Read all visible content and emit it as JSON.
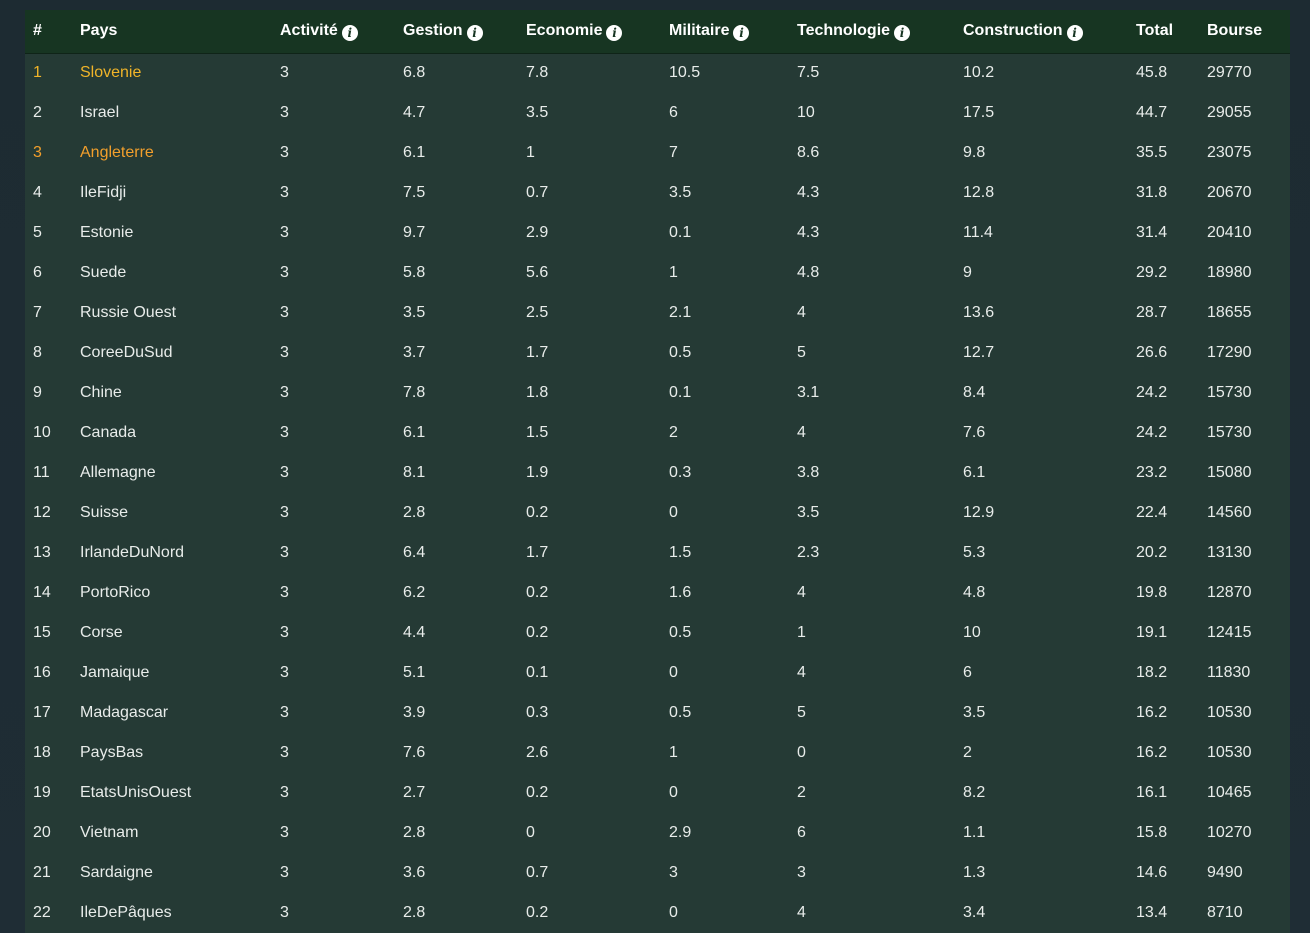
{
  "table": {
    "headers": {
      "rank": "#",
      "country": "Pays",
      "activity": "Activité",
      "management": "Gestion",
      "economy": "Economie",
      "military": "Militaire",
      "technology": "Technologie",
      "construction": "Construction",
      "total": "Total",
      "stock": "Bourse"
    },
    "info_icon_glyph": "i",
    "highlight_colors": {
      "gold": "#f0b429",
      "orange": "#f29f2c"
    },
    "rows": [
      {
        "rank": "1",
        "country": "Slovenie",
        "activity": "3",
        "management": "6.8",
        "economy": "7.8",
        "military": "10.5",
        "technology": "7.5",
        "construction": "10.2",
        "total": "45.8",
        "stock": "29770",
        "highlight": "gold"
      },
      {
        "rank": "2",
        "country": "Israel",
        "activity": "3",
        "management": "4.7",
        "economy": "3.5",
        "military": "6",
        "technology": "10",
        "construction": "17.5",
        "total": "44.7",
        "stock": "29055",
        "highlight": ""
      },
      {
        "rank": "3",
        "country": "Angleterre",
        "activity": "3",
        "management": "6.1",
        "economy": "1",
        "military": "7",
        "technology": "8.6",
        "construction": "9.8",
        "total": "35.5",
        "stock": "23075",
        "highlight": "orange"
      },
      {
        "rank": "4",
        "country": "IleFidji",
        "activity": "3",
        "management": "7.5",
        "economy": "0.7",
        "military": "3.5",
        "technology": "4.3",
        "construction": "12.8",
        "total": "31.8",
        "stock": "20670",
        "highlight": ""
      },
      {
        "rank": "5",
        "country": "Estonie",
        "activity": "3",
        "management": "9.7",
        "economy": "2.9",
        "military": "0.1",
        "technology": "4.3",
        "construction": "11.4",
        "total": "31.4",
        "stock": "20410",
        "highlight": ""
      },
      {
        "rank": "6",
        "country": "Suede",
        "activity": "3",
        "management": "5.8",
        "economy": "5.6",
        "military": "1",
        "technology": "4.8",
        "construction": "9",
        "total": "29.2",
        "stock": "18980",
        "highlight": ""
      },
      {
        "rank": "7",
        "country": "Russie Ouest",
        "activity": "3",
        "management": "3.5",
        "economy": "2.5",
        "military": "2.1",
        "technology": "4",
        "construction": "13.6",
        "total": "28.7",
        "stock": "18655",
        "highlight": ""
      },
      {
        "rank": "8",
        "country": "CoreeDuSud",
        "activity": "3",
        "management": "3.7",
        "economy": "1.7",
        "military": "0.5",
        "technology": "5",
        "construction": "12.7",
        "total": "26.6",
        "stock": "17290",
        "highlight": ""
      },
      {
        "rank": "9",
        "country": "Chine",
        "activity": "3",
        "management": "7.8",
        "economy": "1.8",
        "military": "0.1",
        "technology": "3.1",
        "construction": "8.4",
        "total": "24.2",
        "stock": "15730",
        "highlight": ""
      },
      {
        "rank": "10",
        "country": "Canada",
        "activity": "3",
        "management": "6.1",
        "economy": "1.5",
        "military": "2",
        "technology": "4",
        "construction": "7.6",
        "total": "24.2",
        "stock": "15730",
        "highlight": ""
      },
      {
        "rank": "11",
        "country": "Allemagne",
        "activity": "3",
        "management": "8.1",
        "economy": "1.9",
        "military": "0.3",
        "technology": "3.8",
        "construction": "6.1",
        "total": "23.2",
        "stock": "15080",
        "highlight": ""
      },
      {
        "rank": "12",
        "country": "Suisse",
        "activity": "3",
        "management": "2.8",
        "economy": "0.2",
        "military": "0",
        "technology": "3.5",
        "construction": "12.9",
        "total": "22.4",
        "stock": "14560",
        "highlight": ""
      },
      {
        "rank": "13",
        "country": "IrlandeDuNord",
        "activity": "3",
        "management": "6.4",
        "economy": "1.7",
        "military": "1.5",
        "technology": "2.3",
        "construction": "5.3",
        "total": "20.2",
        "stock": "13130",
        "highlight": ""
      },
      {
        "rank": "14",
        "country": "PortoRico",
        "activity": "3",
        "management": "6.2",
        "economy": "0.2",
        "military": "1.6",
        "technology": "4",
        "construction": "4.8",
        "total": "19.8",
        "stock": "12870",
        "highlight": ""
      },
      {
        "rank": "15",
        "country": "Corse",
        "activity": "3",
        "management": "4.4",
        "economy": "0.2",
        "military": "0.5",
        "technology": "1",
        "construction": "10",
        "total": "19.1",
        "stock": "12415",
        "highlight": ""
      },
      {
        "rank": "16",
        "country": "Jamaique",
        "activity": "3",
        "management": "5.1",
        "economy": "0.1",
        "military": "0",
        "technology": "4",
        "construction": "6",
        "total": "18.2",
        "stock": "11830",
        "highlight": ""
      },
      {
        "rank": "17",
        "country": "Madagascar",
        "activity": "3",
        "management": "3.9",
        "economy": "0.3",
        "military": "0.5",
        "technology": "5",
        "construction": "3.5",
        "total": "16.2",
        "stock": "10530",
        "highlight": ""
      },
      {
        "rank": "18",
        "country": "PaysBas",
        "activity": "3",
        "management": "7.6",
        "economy": "2.6",
        "military": "1",
        "technology": "0",
        "construction": "2",
        "total": "16.2",
        "stock": "10530",
        "highlight": ""
      },
      {
        "rank": "19",
        "country": "EtatsUnisOuest",
        "activity": "3",
        "management": "2.7",
        "economy": "0.2",
        "military": "0",
        "technology": "2",
        "construction": "8.2",
        "total": "16.1",
        "stock": "10465",
        "highlight": ""
      },
      {
        "rank": "20",
        "country": "Vietnam",
        "activity": "3",
        "management": "2.8",
        "economy": "0",
        "military": "2.9",
        "technology": "6",
        "construction": "1.1",
        "total": "15.8",
        "stock": "10270",
        "highlight": ""
      },
      {
        "rank": "21",
        "country": "Sardaigne",
        "activity": "3",
        "management": "3.6",
        "economy": "0.7",
        "military": "3",
        "technology": "3",
        "construction": "1.3",
        "total": "14.6",
        "stock": "9490",
        "highlight": ""
      },
      {
        "rank": "22",
        "country": "IleDePâques",
        "activity": "3",
        "management": "2.8",
        "economy": "0.2",
        "military": "0",
        "technology": "4",
        "construction": "3.4",
        "total": "13.4",
        "stock": "8710",
        "highlight": ""
      }
    ]
  }
}
